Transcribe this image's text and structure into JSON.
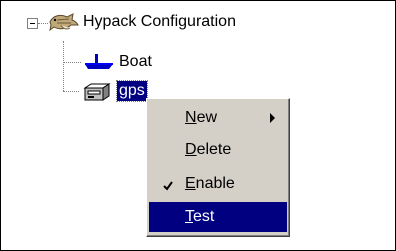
{
  "tree": {
    "root": {
      "label": "Hypack Configuration",
      "icon": "hypack-fish-icon"
    },
    "children": [
      {
        "label": "Boat",
        "icon": "boat-icon"
      },
      {
        "label": "gps",
        "icon": "device-icon",
        "selected": true
      }
    ]
  },
  "context_menu": {
    "items": [
      {
        "label": "New",
        "mnemonic": "N",
        "rest": "ew",
        "has_submenu": true
      },
      {
        "label": "Delete",
        "mnemonic": "D",
        "rest": "elete"
      },
      {
        "label": "Enable",
        "mnemonic": "E",
        "rest": "nable",
        "checked": true
      },
      {
        "label": "Test",
        "mnemonic": "T",
        "rest": "est",
        "highlighted": true
      }
    ]
  },
  "colors": {
    "selection": "#000080",
    "menu_bg": "#d4d0c8"
  }
}
